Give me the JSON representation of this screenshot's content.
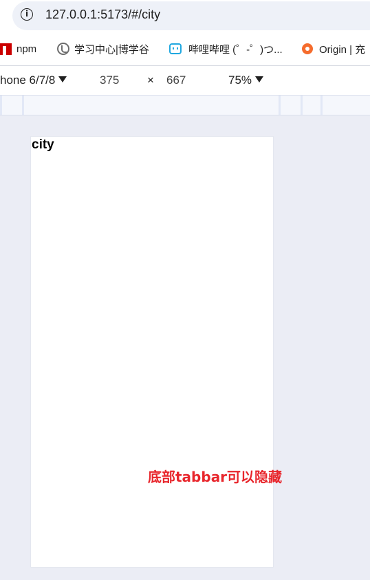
{
  "address_bar": {
    "url": "127.0.0.1:5173/#/city",
    "info_icon": "info-icon"
  },
  "bookmarks": [
    {
      "label": "npm",
      "icon": "npm-icon"
    },
    {
      "label": "学习中心|博学谷",
      "icon": "globe-icon"
    },
    {
      "label": "哔哩哔哩 (゜-゜)つ...",
      "icon": "bilibili-icon"
    },
    {
      "label": "Origin | 充",
      "icon": "origin-icon"
    }
  ],
  "device_toolbar": {
    "device": "hone 6/7/8",
    "width": "375",
    "times": "×",
    "height": "667",
    "zoom": "75%"
  },
  "page": {
    "heading": "city"
  },
  "annotation": {
    "text": "底部tabbar可以隐藏",
    "color": "#e8262c"
  }
}
